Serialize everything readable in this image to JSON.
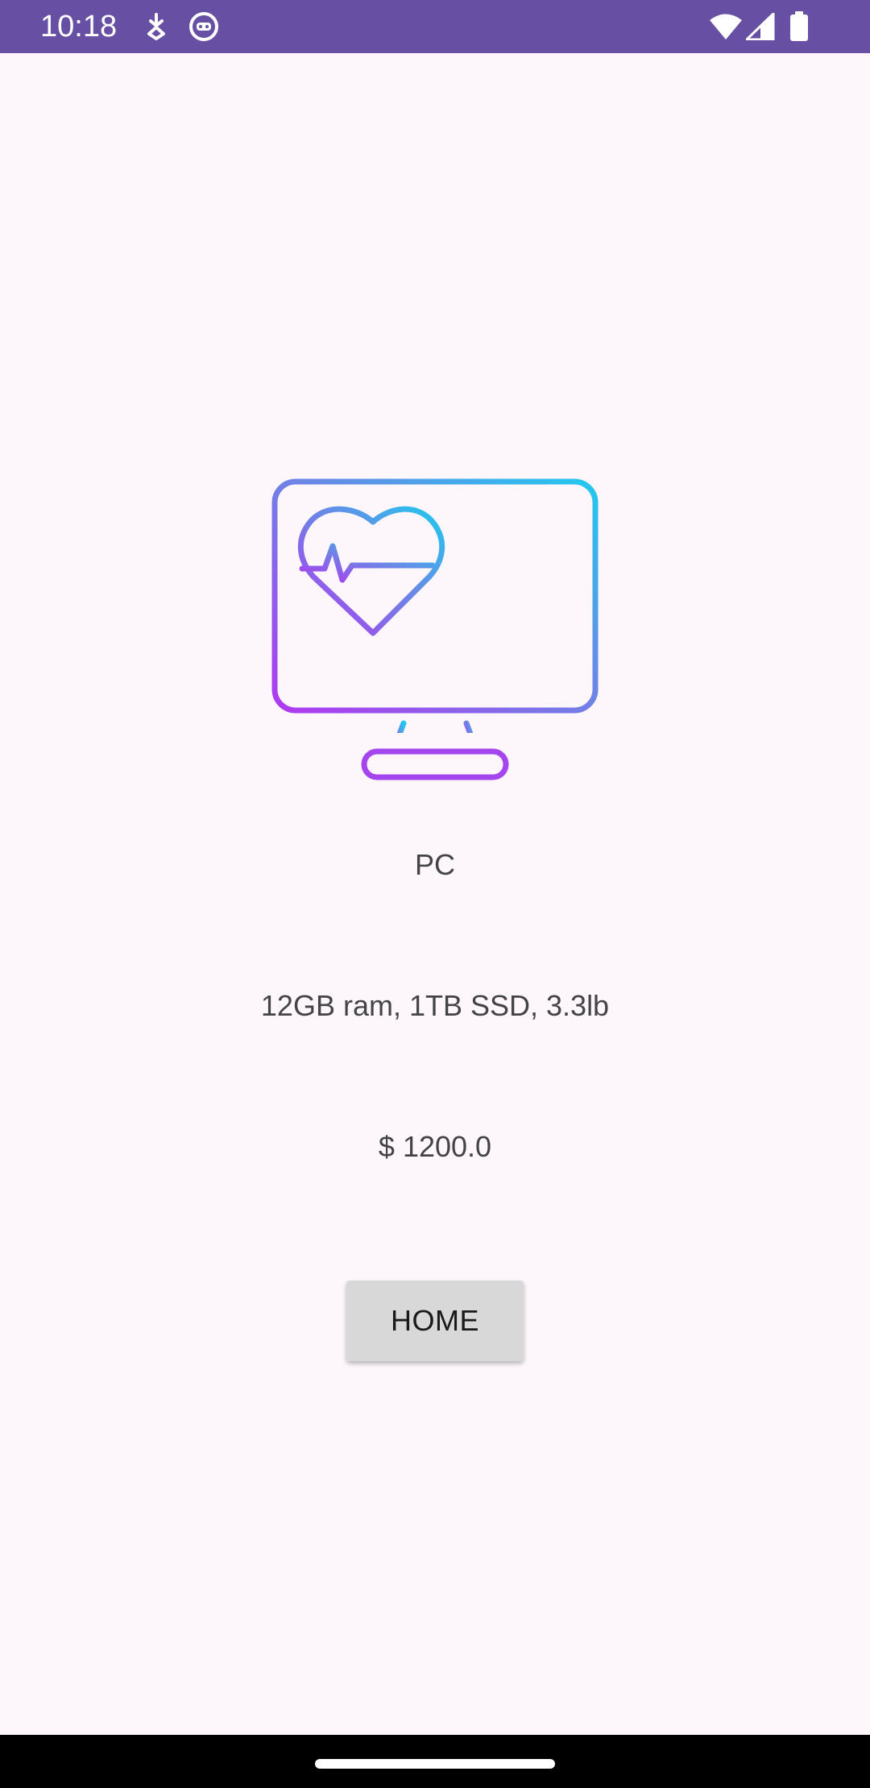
{
  "status_bar": {
    "time": "10:18",
    "icons": [
      "download-arrow-icon",
      "robot-face-icon",
      "wifi-icon",
      "cellular-signal-icon",
      "battery-icon"
    ]
  },
  "product": {
    "image_icon": "monitor-heartbeat-icon",
    "name": "PC",
    "specs": "12GB ram, 1TB SSD, 3.3lb",
    "price": "$ 1200.0"
  },
  "actions": {
    "home_label": "HOME"
  },
  "colors": {
    "status_bar": "#6750a4",
    "background": "#fdf7fc",
    "button": "#d8d8d8",
    "gradient_start": "#b039f0",
    "gradient_end": "#22c8ee"
  }
}
